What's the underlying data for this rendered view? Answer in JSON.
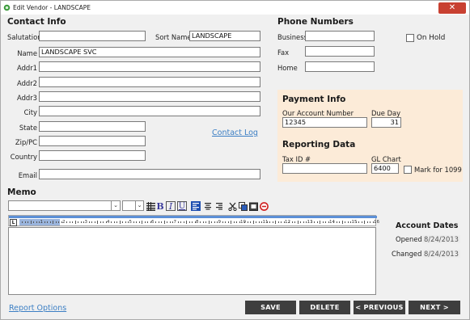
{
  "window": {
    "title": "Edit Vendor - LANDSCAPE",
    "close_glyph": "✕"
  },
  "contact_info": {
    "heading": "Contact Info",
    "salutation_label": "Salutation",
    "salutation_value": "",
    "sort_name_label": "Sort Name",
    "sort_name_value": "LANDSCAPE",
    "name_label": "Name",
    "name_value": "LANDSCAPE SVC",
    "addr1_label": "Addr1",
    "addr1_value": "",
    "addr2_label": "Addr2",
    "addr2_value": "",
    "addr3_label": "Addr3",
    "addr3_value": "",
    "city_label": "City",
    "city_value": "",
    "state_label": "State",
    "state_value": "",
    "zip_label": "Zip/PC",
    "zip_value": "",
    "country_label": "Country",
    "country_value": "",
    "email_label": "Email",
    "email_value": "",
    "contact_log_link": "Contact Log"
  },
  "phone_numbers": {
    "heading": "Phone Numbers",
    "business_label": "Business",
    "business_value": "",
    "fax_label": "Fax",
    "fax_value": "",
    "home_label": "Home",
    "home_value": "",
    "on_hold_label": "On Hold",
    "on_hold_checked": false
  },
  "payment_info": {
    "heading": "Payment Info",
    "account_number_label": "Our Account Number",
    "account_number_value": "12345",
    "due_day_label": "Due Day",
    "due_day_value": "31"
  },
  "reporting_data": {
    "heading": "Reporting Data",
    "tax_id_label": "Tax ID #",
    "tax_id_value": "",
    "gl_chart_label": "GL Chart",
    "gl_chart_value": "6400",
    "mark_1099_label": "Mark for 1099",
    "mark_1099_checked": false
  },
  "memo": {
    "heading": "Memo",
    "font_select_value": "",
    "size_select_value": "",
    "toolbar_icons": [
      "bullet-list-icon",
      "bold-icon",
      "italic-icon",
      "underline-icon",
      "align-left-icon",
      "align-center-icon",
      "align-right-icon",
      "cut-icon",
      "copy-icon",
      "paste-icon",
      "clear-icon"
    ],
    "bold_glyph": "B",
    "italic_glyph": "I",
    "underline_glyph": "U",
    "ruler_numbers": [
      "1",
      "2",
      "3",
      "4",
      "5",
      "6",
      "7",
      "8",
      "9",
      "10",
      "11",
      "12",
      "13",
      "14",
      "15",
      "16"
    ],
    "text": ""
  },
  "account_dates": {
    "heading": "Account Dates",
    "opened_label": "Opened",
    "opened_value": "8/24/2013",
    "changed_label": "Changed",
    "changed_value": "8/24/2013"
  },
  "footer": {
    "report_options_link": "Report Options",
    "save_label": "SAVE",
    "delete_label": "DELETE",
    "previous_label": "< PREVIOUS",
    "next_label": "NEXT >"
  },
  "colors": {
    "title_accent": "#2a7fd4",
    "close": "#c84031",
    "button_bg": "#3e3e3e",
    "panel_bg": "#fcebd8",
    "link": "#3c7fc4",
    "ruler_bg": "#5b8fd6"
  }
}
